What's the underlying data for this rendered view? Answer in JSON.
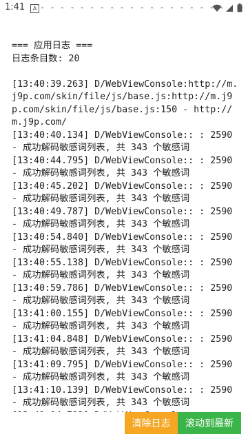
{
  "status_bar": {
    "time": "1:41",
    "notif_glyph": "A",
    "dashes": "- - - - - - - - - - - - - - - - - - - - -",
    "icons": [
      "wifi-icon",
      "signal-icon",
      "battery-icon"
    ]
  },
  "header": {
    "title": "=== 应用日志 ===",
    "count_label": "日志条目数: 20"
  },
  "logs": [
    "[13:40:39.263] D/WebViewConsole:http://m.j9p.com/skin/file/js/base.js:http://m.j9p.com/skin/file/js/base.js:150 - http://m.j9p.com/",
    "[13:40:40.134] D/WebViewConsole:: : 2590 - 成功解码敏感词列表, 共 343 个敏感词",
    "[13:40:44.795] D/WebViewConsole:: : 2590 - 成功解码敏感词列表, 共 343 个敏感词",
    "[13:40:45.202] D/WebViewConsole:: : 2590 - 成功解码敏感词列表, 共 343 个敏感词",
    "[13:40:49.787] D/WebViewConsole:: : 2590 - 成功解码敏感词列表, 共 343 个敏感词",
    "[13:40:54.840] D/WebViewConsole:: : 2590 - 成功解码敏感词列表, 共 343 个敏感词",
    "[13:40:55.138] D/WebViewConsole:: : 2590 - 成功解码敏感词列表, 共 343 个敏感词",
    "[13:40:59.786] D/WebViewConsole:: : 2590 - 成功解码敏感词列表, 共 343 个敏感词",
    "[13:41:00.155] D/WebViewConsole:: : 2590 - 成功解码敏感词列表, 共 343 个敏感词",
    "[13:41:04.848] D/WebViewConsole:: : 2590 - 成功解码敏感词列表, 共 343 个敏感词",
    "[13:41:09.795] D/WebViewConsole:: : 2590 - 成功解码敏感词列表, 共 343 个敏感词",
    "[13:41:10.139] D/WebViewConsole:: : 2590 - 成功解码敏感词列表, 共 343 个敏感词",
    "[13:41:14.792] D/WebViewConsole:: :"
  ],
  "buttons": {
    "clear_label": "清除日志",
    "scroll_label": "滚动到最新"
  },
  "colors": {
    "clear_button": "#f5a623",
    "scroll_button": "#3bb54a",
    "text": "#222222"
  }
}
